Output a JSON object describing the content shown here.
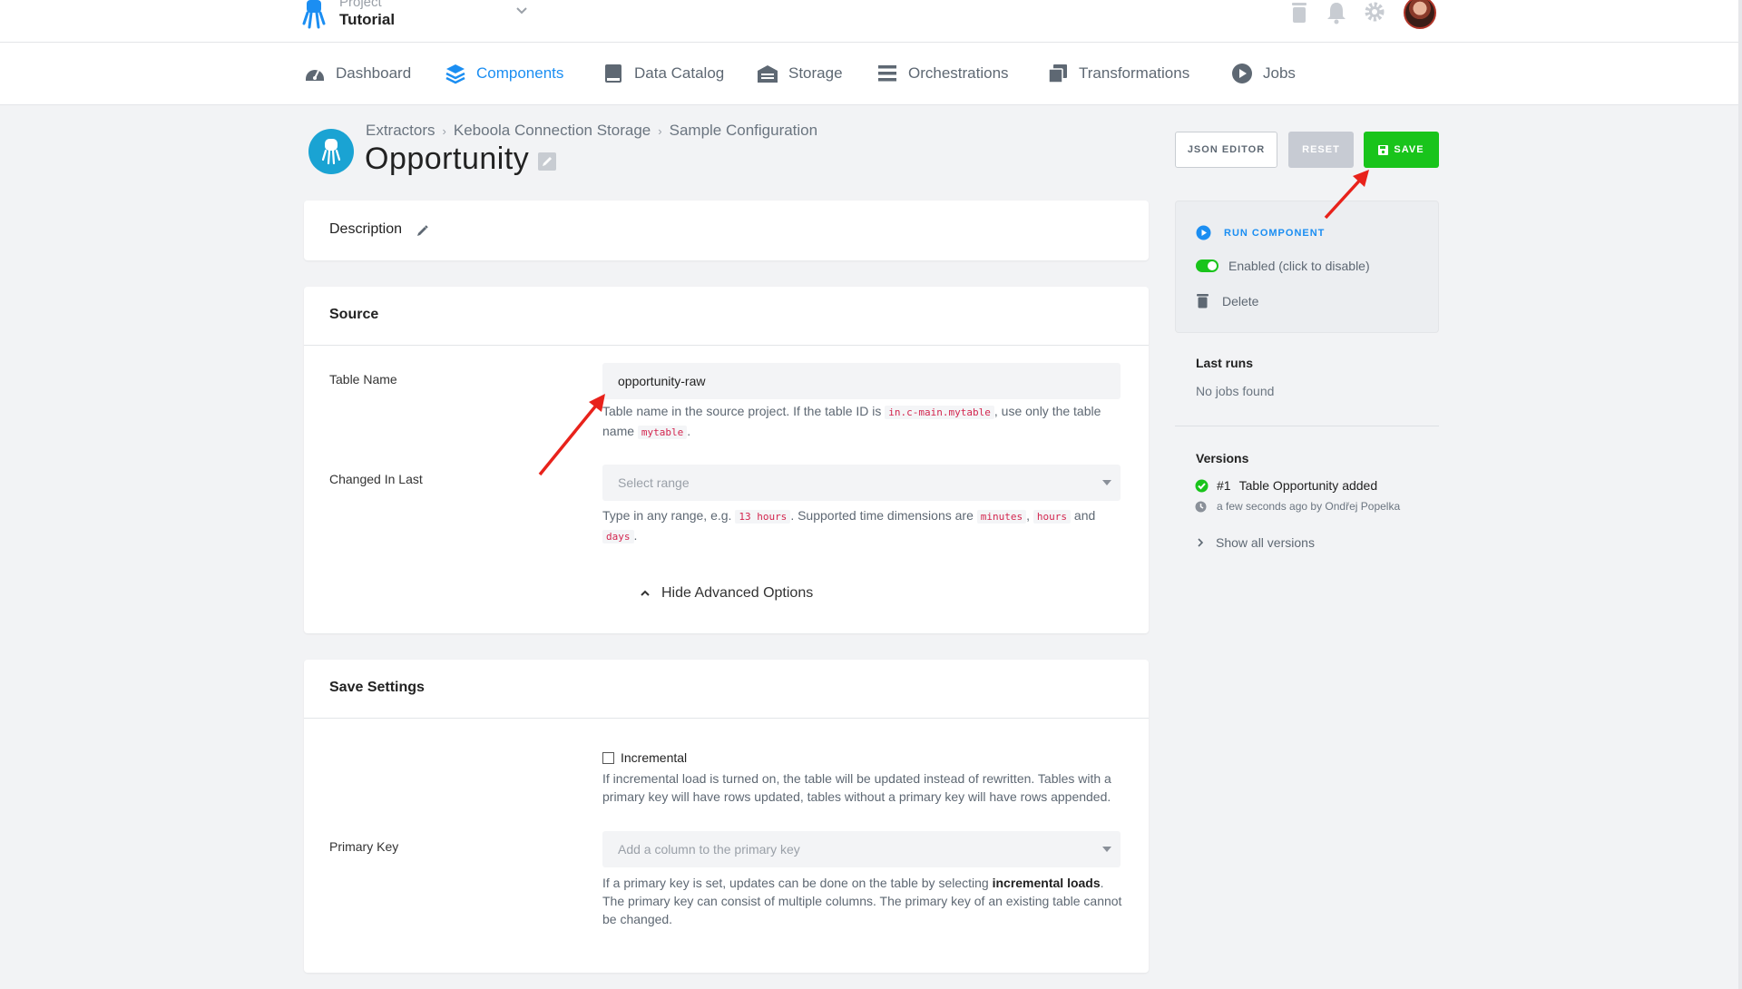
{
  "header": {
    "project_label": "Project",
    "project_name": "Tutorial"
  },
  "nav": {
    "items": [
      {
        "label": "Dashboard",
        "icon": "dashboard-icon"
      },
      {
        "label": "Components",
        "icon": "layers-icon",
        "active": true
      },
      {
        "label": "Data Catalog",
        "icon": "book-icon"
      },
      {
        "label": "Storage",
        "icon": "warehouse-icon"
      },
      {
        "label": "Orchestrations",
        "icon": "bars-icon"
      },
      {
        "label": "Transformations",
        "icon": "window-icon"
      },
      {
        "label": "Jobs",
        "icon": "play-circle-icon"
      }
    ]
  },
  "breadcrumb": {
    "items": [
      "Extractors",
      "Keboola Connection Storage",
      "Sample Configuration"
    ]
  },
  "page": {
    "title": "Opportunity"
  },
  "actions": {
    "json_editor": "JSON EDITOR",
    "reset": "RESET",
    "save": "SAVE"
  },
  "description_card": {
    "title": "Description"
  },
  "source_card": {
    "title": "Source",
    "table_name_label": "Table Name",
    "table_name_value": "opportunity-raw",
    "table_help": {
      "part1": "Table name in the source project. If the table ID is ",
      "code1": "in.c-main.mytable",
      "part2": ", use only the table name ",
      "code2": "mytable",
      "part3": "."
    },
    "changed_label": "Changed In Last",
    "changed_placeholder": "Select range",
    "changed_help": {
      "part1": "Type in any range, e.g. ",
      "code1": "13 hours",
      "part2": ". Supported time dimensions are ",
      "code2": "minutes",
      "part3": ", ",
      "code3": "hours",
      "part4": " and ",
      "code4": "days",
      "part5": "."
    },
    "advanced_toggle": "Hide Advanced Options"
  },
  "save_card": {
    "title": "Save Settings",
    "incremental_label": "Incremental",
    "incremental_help": "If incremental load is turned on, the table will be updated instead of rewritten. Tables with a primary key will have rows updated, tables without a primary key will have rows appended.",
    "primary_key_label": "Primary Key",
    "primary_key_placeholder": "Add a column to the primary key",
    "pk_help": {
      "part1": "If a primary key is set, updates can be done on the table by selecting ",
      "bold": "incremental loads",
      "part2": ". The primary key can consist of multiple columns. The primary key of an existing table cannot be changed."
    }
  },
  "sidebar": {
    "run_component": "RUN COMPONENT",
    "enabled": "Enabled (click to disable)",
    "delete": "Delete",
    "last_runs_title": "Last runs",
    "last_runs_empty": "No jobs found",
    "versions_title": "Versions",
    "version_number": "#1",
    "version_title": "Table Opportunity added",
    "version_meta": "a few seconds ago by Ondřej Popelka",
    "show_all_versions": "Show all versions"
  },
  "colors": {
    "accent": "#1b8ef2",
    "save_green": "#19c41b",
    "annotation_red": "#e8221b"
  }
}
